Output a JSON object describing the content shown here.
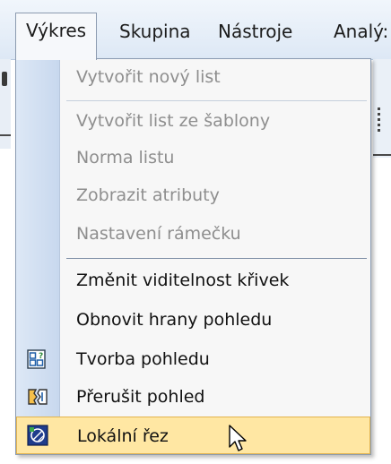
{
  "menubar": {
    "items": [
      {
        "label": "Výkres"
      },
      {
        "label": "Skupina"
      },
      {
        "label": "Nástroje"
      },
      {
        "label": "Analý:"
      }
    ]
  },
  "dropdown": {
    "items": [
      {
        "label": "Vytvořit nový list",
        "enabled": false
      },
      {
        "label": "Vytvořit list ze šablony",
        "enabled": false
      },
      {
        "label": "Norma listu",
        "enabled": false
      },
      {
        "label": "Zobrazit atributy",
        "enabled": false
      },
      {
        "label": "Nastavení rámečku",
        "enabled": false
      },
      {
        "label": "Změnit viditelnost křivek",
        "enabled": true
      },
      {
        "label": "Obnovit hrany pohledu",
        "enabled": true
      },
      {
        "label": "Tvorba pohledu",
        "enabled": true,
        "icon": "view-creation-icon"
      },
      {
        "label": "Přerušit pohled",
        "enabled": true,
        "icon": "break-view-icon"
      },
      {
        "label": "Lokální řez",
        "enabled": true,
        "icon": "local-section-icon",
        "highlighted": true
      }
    ]
  },
  "colors": {
    "highlight_bg": "#ffe7a3",
    "highlight_border": "#e3b44e",
    "disabled_text": "#8e8e8e"
  }
}
